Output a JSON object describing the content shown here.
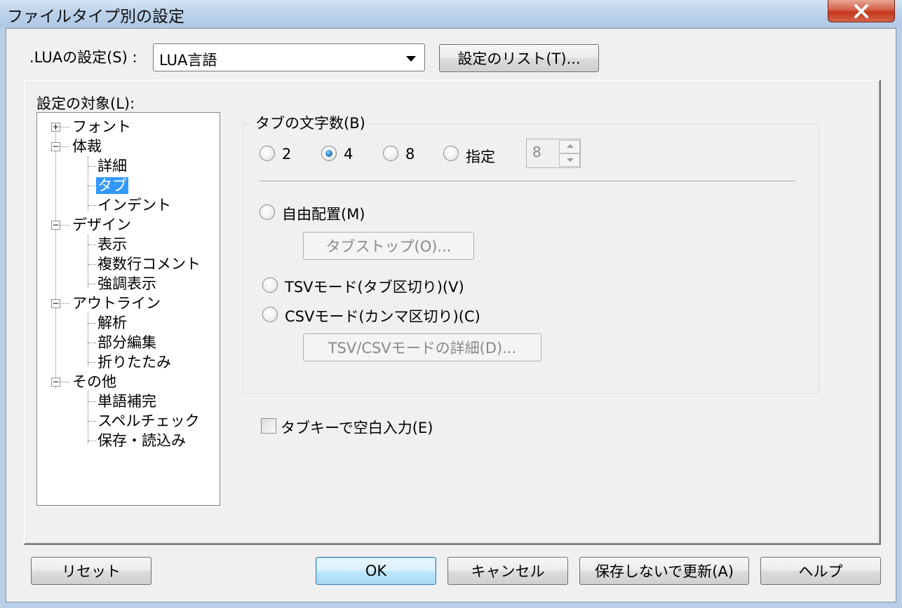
{
  "window": {
    "title": "ファイルタイプ別の設定",
    "close_icon": "close-icon"
  },
  "top": {
    "label": ".LUAの設定(S) :",
    "combo_value": "LUA言語",
    "list_button": "設定のリスト(T)..."
  },
  "panel": {
    "label": "設定の対象(L):"
  },
  "tree": {
    "font": "フォント",
    "style": "体裁",
    "style_detail": "詳細",
    "style_tab": "タブ",
    "style_indent": "インデント",
    "design": "デザイン",
    "design_display": "表示",
    "design_multiline": "複数行コメント",
    "design_highlight": "強調表示",
    "outline": "アウトライン",
    "outline_parse": "解析",
    "outline_partial": "部分編集",
    "outline_fold": "折りたたみ",
    "other": "その他",
    "other_completion": "単語補完",
    "other_spell": "スペルチェック",
    "other_save": "保存・読込み",
    "plus": "+",
    "minus": "−"
  },
  "tab_group": {
    "label": "タブの文字数(B)",
    "opt2": "2",
    "opt4": "4",
    "opt8": "8",
    "custom": "指定",
    "custom_value": "8",
    "selected": "4",
    "free": "自由配置(M)",
    "tabstop_button": "タブストップ(O)...",
    "tsv": "TSVモード(タブ区切り)(V)",
    "csv": "CSVモード(カンマ区切り)(C)",
    "detail_button": "TSV/CSVモードの詳細(D)..."
  },
  "checkbox": {
    "label": "タブキーで空白入力(E)",
    "checked": false
  },
  "footer": {
    "reset": "リセット",
    "ok": "OK",
    "cancel": "キャンセル",
    "update_no_save": "保存しないで更新(A)",
    "help": "ヘルプ"
  }
}
